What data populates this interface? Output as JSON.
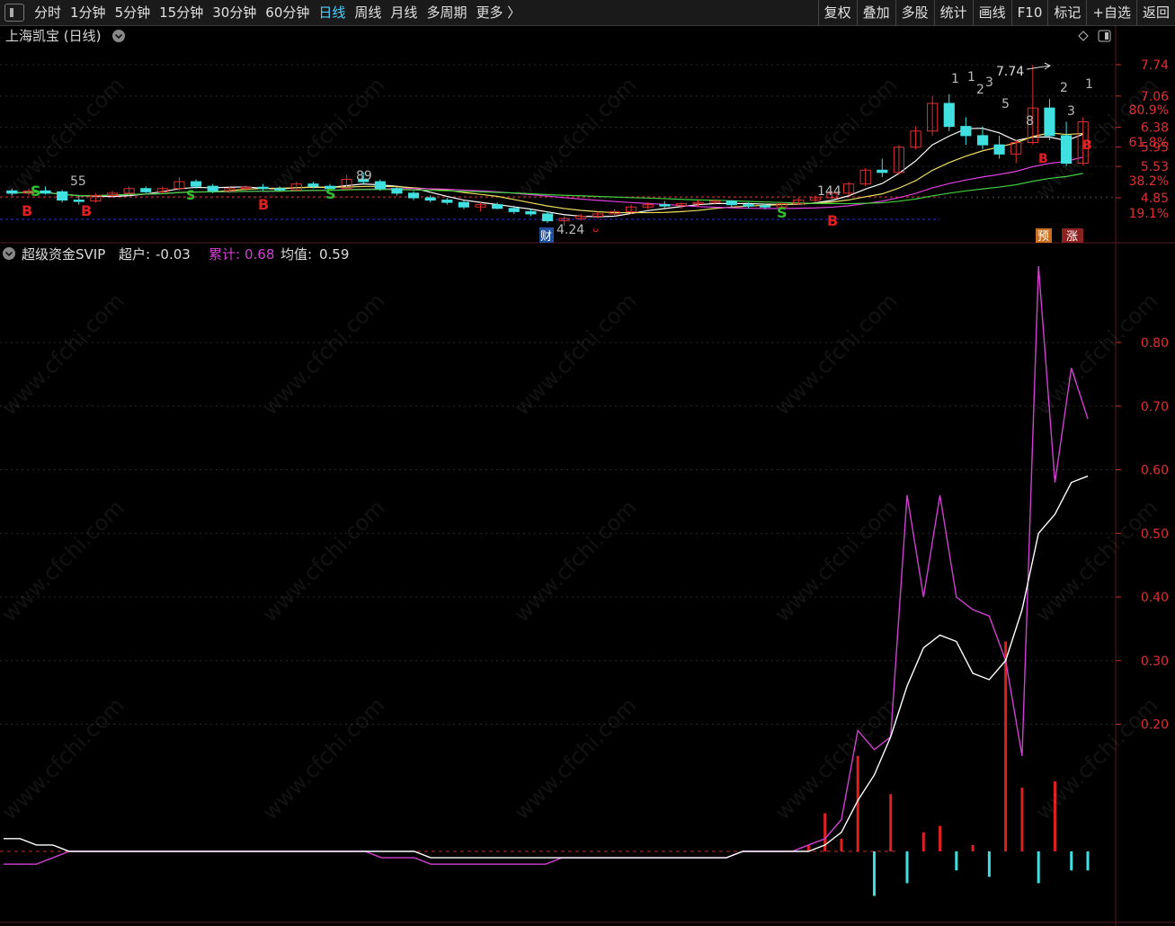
{
  "toolbar": {
    "periods": [
      "分时",
      "1分钟",
      "5分钟",
      "15分钟",
      "30分钟",
      "60分钟",
      "日线",
      "周线",
      "月线",
      "多周期",
      "更多 〉"
    ],
    "active_period": "日线",
    "tools": [
      "复权",
      "叠加",
      "多股",
      "统计",
      "画线",
      "F10",
      "标记",
      "+自选",
      "返回"
    ]
  },
  "price_panel": {
    "title": "上海凯宝 (日线)",
    "ticks": [
      "7.74",
      "7.06",
      "6.38",
      "5.95",
      "5.53",
      "4.85"
    ],
    "fib_labels": [
      "80.9%",
      "61.8%",
      "38.2%",
      "19.1%"
    ],
    "annotations": {
      "high": "7.74",
      "low": "4.24",
      "fib_55": "55",
      "fib_89": "89",
      "fib_144": "144",
      "wave_1a": "1",
      "wave_1b": "1",
      "wave_2a": "2",
      "wave_3a": "3",
      "wave_5": "5",
      "wave_8": "8",
      "wave_2b": "2",
      "wave_1c": "1",
      "wave_3b": "3"
    },
    "signal_b": "B",
    "signal_s": "S",
    "badge_cai": "财",
    "badge_yu": "预",
    "badge_zhang": "涨",
    "ma_colors": {
      "ma5": "#ffffff",
      "ma10": "#f0e060",
      "ma20": "#e040e0",
      "ma30": "#40d040"
    }
  },
  "indicator_panel": {
    "name": "超级资金SVIP",
    "field1_label": "超户:",
    "field1_value": "-0.03",
    "field2_label": "累计:",
    "field2_value": "0.68",
    "field3_label": "均值:",
    "field3_value": "0.59",
    "ticks": [
      "0.80",
      "0.70",
      "0.60",
      "0.50",
      "0.40",
      "0.30",
      "0.20"
    ],
    "colors": {
      "chaohu": "#ffffff",
      "leiji": "#d040d0",
      "junzhi": "#ffffff",
      "positive": "#e02020",
      "negative": "#40e0e0"
    }
  },
  "watermark": "www.cfchi.com",
  "chart_data": [
    {
      "type": "candlestick",
      "title": "上海凯宝 (日线)",
      "yticks": [
        7.74,
        7.06,
        6.38,
        5.95,
        5.53,
        4.85
      ],
      "fib_levels": [
        {
          "label": "80.9%",
          "value": 7.06
        },
        {
          "label": "61.8%",
          "value": 5.95
        },
        {
          "label": "38.2%",
          "value": 5.53
        },
        {
          "label": "19.1%",
          "value": 4.65
        }
      ],
      "ohlc": [
        [
          5.0,
          5.05,
          4.9,
          4.95
        ],
        [
          4.95,
          5.05,
          4.9,
          5.0
        ],
        [
          5.0,
          5.1,
          4.92,
          4.95
        ],
        [
          4.98,
          5.02,
          4.75,
          4.8
        ],
        [
          4.8,
          4.88,
          4.7,
          4.78
        ],
        [
          4.78,
          4.95,
          4.75,
          4.9
        ],
        [
          4.9,
          5.0,
          4.85,
          4.95
        ],
        [
          4.95,
          5.1,
          4.9,
          5.05
        ],
        [
          5.05,
          5.1,
          4.95,
          4.98
        ],
        [
          4.98,
          5.1,
          4.95,
          5.05
        ],
        [
          5.05,
          5.3,
          5.0,
          5.2
        ],
        [
          5.2,
          5.25,
          5.05,
          5.1
        ],
        [
          5.1,
          5.15,
          4.95,
          5.0
        ],
        [
          5.0,
          5.1,
          4.95,
          5.05
        ],
        [
          5.05,
          5.12,
          5.0,
          5.08
        ],
        [
          5.08,
          5.15,
          5.0,
          5.05
        ],
        [
          5.05,
          5.1,
          5.0,
          5.02
        ],
        [
          5.02,
          5.2,
          5.0,
          5.15
        ],
        [
          5.15,
          5.2,
          5.05,
          5.1
        ],
        [
          5.1,
          5.15,
          5.0,
          5.05
        ],
        [
          5.05,
          5.35,
          5.0,
          5.25
        ],
        [
          5.25,
          5.4,
          5.15,
          5.2
        ],
        [
          5.2,
          5.25,
          5.0,
          5.05
        ],
        [
          5.05,
          5.1,
          4.9,
          4.95
        ],
        [
          4.95,
          5.0,
          4.8,
          4.85
        ],
        [
          4.85,
          4.9,
          4.75,
          4.8
        ],
        [
          4.8,
          4.85,
          4.7,
          4.75
        ],
        [
          4.75,
          4.8,
          4.6,
          4.65
        ],
        [
          4.65,
          4.75,
          4.55,
          4.7
        ],
        [
          4.7,
          4.75,
          4.6,
          4.62
        ],
        [
          4.62,
          4.68,
          4.5,
          4.55
        ],
        [
          4.55,
          4.6,
          4.45,
          4.5
        ],
        [
          4.5,
          4.55,
          4.3,
          4.35
        ],
        [
          4.35,
          4.45,
          4.24,
          4.4
        ],
        [
          4.4,
          4.5,
          4.35,
          4.45
        ],
        [
          4.45,
          4.55,
          4.4,
          4.5
        ],
        [
          4.5,
          4.6,
          4.45,
          4.55
        ],
        [
          4.55,
          4.7,
          4.5,
          4.65
        ],
        [
          4.65,
          4.75,
          4.6,
          4.7
        ],
        [
          4.7,
          4.78,
          4.62,
          4.68
        ],
        [
          4.68,
          4.75,
          4.6,
          4.72
        ],
        [
          4.72,
          4.8,
          4.65,
          4.75
        ],
        [
          4.75,
          4.82,
          4.7,
          4.78
        ],
        [
          4.78,
          4.8,
          4.65,
          4.7
        ],
        [
          4.7,
          4.75,
          4.62,
          4.68
        ],
        [
          4.68,
          4.72,
          4.6,
          4.65
        ],
        [
          4.65,
          4.75,
          4.6,
          4.72
        ],
        [
          4.72,
          4.85,
          4.7,
          4.8
        ],
        [
          4.8,
          4.9,
          4.75,
          4.85
        ],
        [
          4.85,
          5.0,
          4.8,
          4.95
        ],
        [
          4.95,
          5.2,
          4.9,
          5.15
        ],
        [
          5.15,
          5.5,
          5.1,
          5.45
        ],
        [
          5.45,
          5.7,
          5.3,
          5.4
        ],
        [
          5.4,
          6.0,
          5.35,
          5.95
        ],
        [
          5.95,
          6.4,
          5.9,
          6.3
        ],
        [
          6.3,
          7.06,
          6.2,
          6.9
        ],
        [
          6.9,
          7.1,
          6.3,
          6.4
        ],
        [
          6.4,
          6.6,
          6.0,
          6.2
        ],
        [
          6.2,
          6.4,
          5.9,
          6.0
        ],
        [
          6.0,
          6.2,
          5.7,
          5.8
        ],
        [
          5.8,
          6.1,
          5.6,
          6.05
        ],
        [
          6.05,
          7.74,
          6.0,
          6.8
        ],
        [
          6.8,
          7.0,
          6.1,
          6.2
        ],
        [
          6.2,
          6.5,
          5.53,
          5.6
        ],
        [
          5.6,
          6.6,
          5.55,
          6.5
        ]
      ]
    },
    {
      "type": "line",
      "title": "超级资金SVIP",
      "yticks": [
        0.8,
        0.7,
        0.6,
        0.5,
        0.4,
        0.3,
        0.2
      ],
      "series": [
        {
          "name": "累计",
          "values": [
            -0.02,
            -0.02,
            -0.02,
            -0.01,
            0,
            0,
            0,
            0,
            0,
            0,
            0,
            0,
            0,
            0,
            0,
            0,
            0,
            0,
            0,
            0,
            0,
            0,
            0,
            -0.01,
            -0.01,
            -0.01,
            -0.02,
            -0.02,
            -0.02,
            -0.02,
            -0.02,
            -0.02,
            -0.02,
            -0.02,
            -0.01,
            -0.01,
            -0.01,
            -0.01,
            -0.01,
            -0.01,
            -0.01,
            -0.01,
            -0.01,
            -0.01,
            -0.01,
            0,
            0,
            0,
            0,
            0.01,
            0.02,
            0.05,
            0.19,
            0.16,
            0.18,
            0.56,
            0.4,
            0.56,
            0.4,
            0.38,
            0.37,
            0.3,
            0.15,
            0.92,
            0.58,
            0.76,
            0.68
          ]
        },
        {
          "name": "均值",
          "values": [
            0.02,
            0.02,
            0.01,
            0.01,
            0,
            0,
            0,
            0,
            0,
            0,
            0,
            0,
            0,
            0,
            0,
            0,
            0,
            0,
            0,
            0,
            0,
            0,
            0,
            0,
            0,
            0,
            -0.01,
            -0.01,
            -0.01,
            -0.01,
            -0.01,
            -0.01,
            -0.01,
            -0.01,
            -0.01,
            -0.01,
            -0.01,
            -0.01,
            -0.01,
            -0.01,
            -0.01,
            -0.01,
            -0.01,
            -0.01,
            -0.01,
            0,
            0,
            0,
            0,
            0,
            0.01,
            0.03,
            0.08,
            0.12,
            0.18,
            0.26,
            0.32,
            0.34,
            0.33,
            0.28,
            0.27,
            0.3,
            0.38,
            0.5,
            0.53,
            0.58,
            0.59
          ]
        },
        {
          "name": "超户",
          "values": [
            0,
            0,
            0,
            0,
            0,
            0,
            0,
            0,
            0,
            0,
            0,
            0,
            0,
            0,
            0,
            0,
            0,
            0,
            0,
            0,
            0,
            0,
            0,
            0,
            0,
            0,
            0,
            0,
            0,
            0,
            0,
            0,
            0,
            0,
            0,
            0,
            0,
            0,
            0,
            0,
            0,
            0,
            0,
            0,
            0,
            0,
            0,
            0,
            0,
            0.01,
            0.06,
            0.02,
            0.15,
            -0.07,
            0.09,
            -0.05,
            0.03,
            0.04,
            -0.03,
            0.01,
            -0.04,
            0.33,
            0.1,
            -0.05,
            0.11,
            -0.03,
            -0.03
          ]
        }
      ]
    }
  ]
}
